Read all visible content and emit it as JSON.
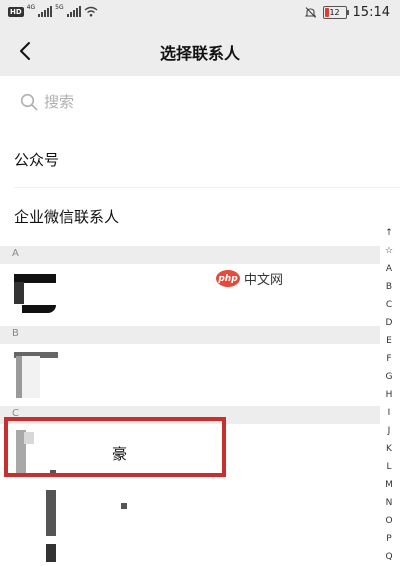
{
  "status_bar": {
    "hd_badge": "HD",
    "signal1_label": "4G",
    "signal2_label": "5G",
    "battery_level": "12",
    "time": "15:14"
  },
  "nav": {
    "title": "选择联系人"
  },
  "search": {
    "placeholder": "搜索"
  },
  "menu": {
    "official_accounts": "公众号",
    "wecom_contacts": "企业微信联系人"
  },
  "sections": [
    {
      "letter": "A"
    },
    {
      "letter": "B"
    },
    {
      "letter": "C"
    }
  ],
  "contacts": {
    "c_highlighted": "豪"
  },
  "watermark": {
    "logo": "php",
    "text": "中文网"
  },
  "index_bar": [
    "↑",
    "☆",
    "A",
    "B",
    "C",
    "D",
    "E",
    "F",
    "G",
    "H",
    "I",
    "J",
    "K",
    "L",
    "M",
    "N",
    "O",
    "P",
    "Q"
  ],
  "colors": {
    "nav_background": "#ededed",
    "highlight_border": "#c8302f",
    "battery_fill": "#e53935"
  }
}
